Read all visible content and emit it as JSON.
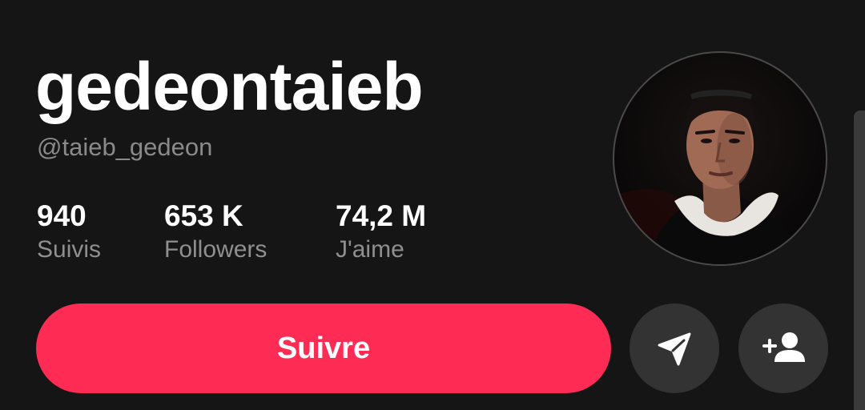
{
  "profile": {
    "display_name": "gedeontaieb",
    "username": "@taieb_gedeon"
  },
  "stats": [
    {
      "value": "940",
      "label": "Suivis"
    },
    {
      "value": "653 K",
      "label": "Followers"
    },
    {
      "value": "74,2 M",
      "label": "J'aime"
    }
  ],
  "actions": {
    "follow_label": "Suivre",
    "message_icon": "send-icon",
    "add_friend_icon": "add-user-icon"
  },
  "colors": {
    "background": "#151515",
    "accent": "#fe2c55",
    "secondary_button": "#333333",
    "muted_text": "#8a8a8a"
  }
}
